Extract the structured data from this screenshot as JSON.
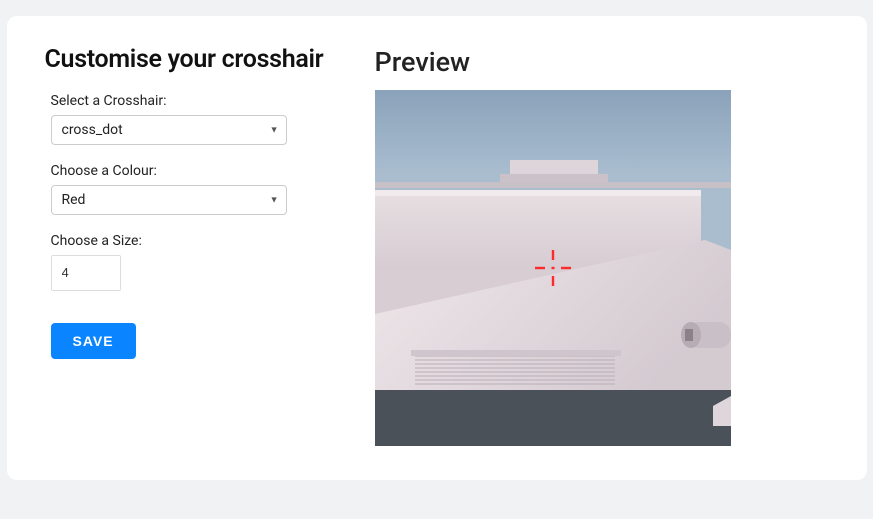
{
  "form": {
    "heading": "Customise your crosshair",
    "crosshair_label": "Select a Crosshair:",
    "crosshair_value": "cross_dot",
    "colour_label": "Choose a Colour:",
    "colour_value": "Red",
    "size_label": "Choose a Size:",
    "size_value": "4",
    "save_label": "SAVE"
  },
  "preview": {
    "heading": "Preview",
    "crosshair_color": "#ff2a2a"
  }
}
